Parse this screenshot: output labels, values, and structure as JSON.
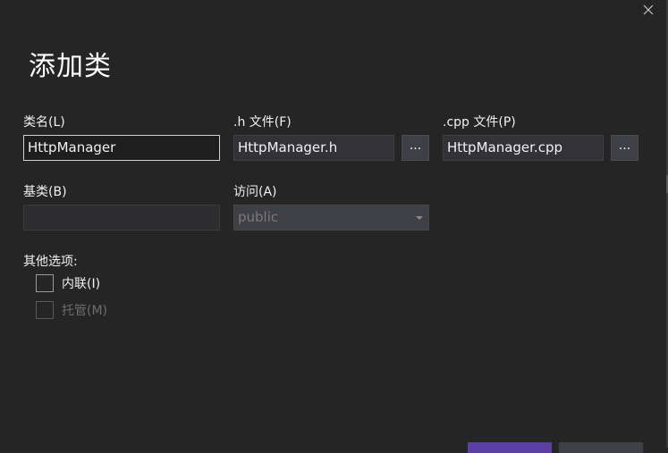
{
  "dialog": {
    "title": "添加类"
  },
  "fields": {
    "class_name": {
      "label": "类名(L)",
      "value": "HttpManager"
    },
    "h_file": {
      "label": ".h 文件(F)",
      "value": "HttpManager.h",
      "browse_label": "..."
    },
    "cpp_file": {
      "label": ".cpp 文件(P)",
      "value": "HttpManager.cpp",
      "browse_label": "..."
    },
    "base_class": {
      "label": "基类(B)",
      "value": ""
    },
    "access": {
      "label": "访问(A)",
      "selected": "public"
    }
  },
  "options": {
    "label": "其他选项:",
    "inline": {
      "label": "内联(I)",
      "checked": false
    },
    "managed": {
      "label": "托管(M)",
      "checked": false,
      "disabled": true
    }
  },
  "icons": {
    "close": "close-icon",
    "dropdown": "chevron-down-icon"
  }
}
